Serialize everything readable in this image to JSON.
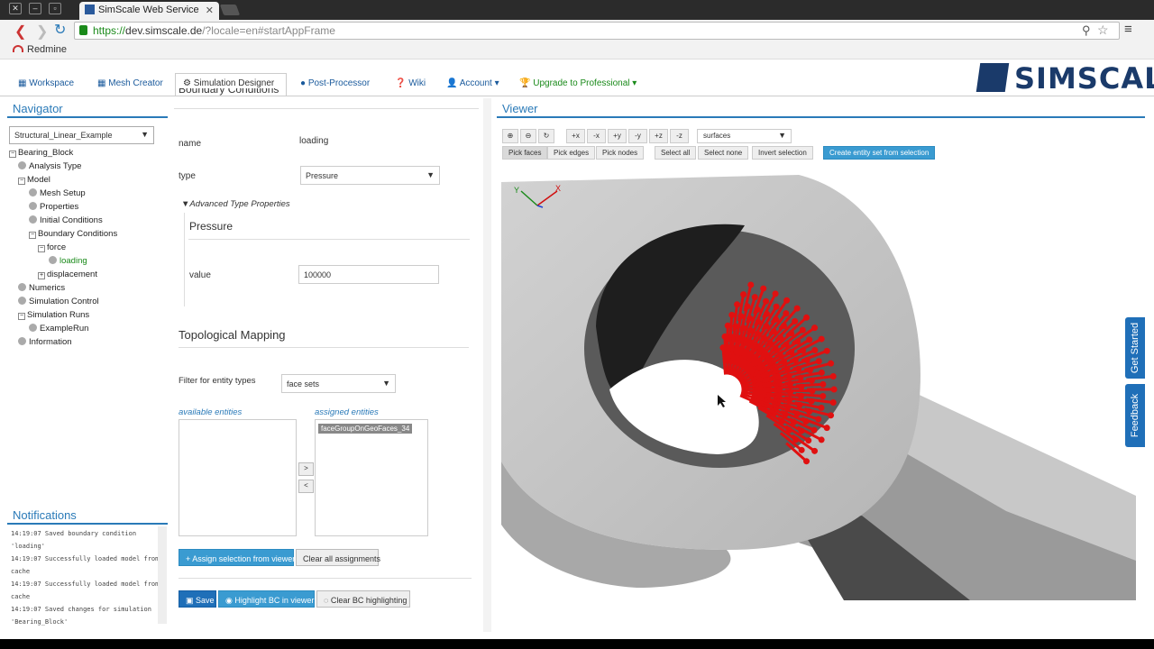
{
  "browser": {
    "tab_title": "SimScale Web Service",
    "url_scheme": "https://",
    "url_host": "dev.simscale.de",
    "url_path": "/?locale=en#startAppFrame",
    "bookmark": "Redmine"
  },
  "nav": {
    "items": [
      {
        "label": "Workspace"
      },
      {
        "label": "Mesh Creator"
      },
      {
        "label": "Simulation Designer"
      },
      {
        "label": "Post-Processor"
      },
      {
        "label": "Wiki"
      },
      {
        "label": "Account"
      },
      {
        "label": "Upgrade to Professional"
      }
    ],
    "logo_text": "SIMSCALE"
  },
  "navigator": {
    "title": "Navigator",
    "project": "Structural_Linear_Example",
    "tree": [
      "Bearing_Block",
      "Analysis Type",
      "Model",
      "Mesh Setup",
      "Properties",
      "Initial Conditions",
      "Boundary Conditions",
      "force",
      "loading",
      "displacement",
      "Numerics",
      "Simulation Control",
      "Simulation Runs",
      "ExampleRun",
      "Information"
    ]
  },
  "notifications": {
    "title": "Notifications",
    "lines": [
      "14:19:07 Saved boundary condition",
      "'loading'",
      "14:19:07 Successfully loaded model from",
      "cache",
      "14:19:07 Successfully loaded model from",
      "cache",
      "14:19:07 Saved changes for simulation",
      "'Bearing_Block'"
    ]
  },
  "form": {
    "header_partial": "Boundary Conditions",
    "name_label": "name",
    "name_value": "loading",
    "type_label": "type",
    "type_value": "Pressure",
    "advanced_label": "Advanced Type Properties",
    "pressure_title": "Pressure",
    "value_label": "value",
    "value_value": "100000",
    "topo_title": "Topological Mapping",
    "filter_label": "Filter for entity types",
    "filter_value": "face sets",
    "available_label": "available entities",
    "assigned_label": "assigned entities",
    "assigned_item": "faceGroupOnGeoFaces_34",
    "move_right": ">",
    "move_left": "<",
    "assign_btn": "Assign selection from viewer",
    "clear_btn": "Clear all assignments",
    "save_btn": "Save",
    "highlight_btn": "Highlight BC in viewer",
    "clear_highlight_btn": "Clear BC highlighting"
  },
  "viewer": {
    "title": "Viewer",
    "view_buttons": [
      "+x",
      "-x",
      "+y",
      "-y",
      "+z",
      "-z"
    ],
    "render_mode": "surfaces",
    "pick_buttons": [
      "Pick faces",
      "Pick edges",
      "Pick nodes"
    ],
    "select_buttons": [
      "Select all",
      "Select none",
      "Invert selection"
    ],
    "create_btn": "Create entity set from selection"
  },
  "side_tabs": {
    "get_started": "Get Started",
    "feedback": "Feedback"
  },
  "colors": {
    "accent": "#2a7ab8",
    "arrow": "#e01010",
    "primary_btn": "#1f6fb8"
  }
}
